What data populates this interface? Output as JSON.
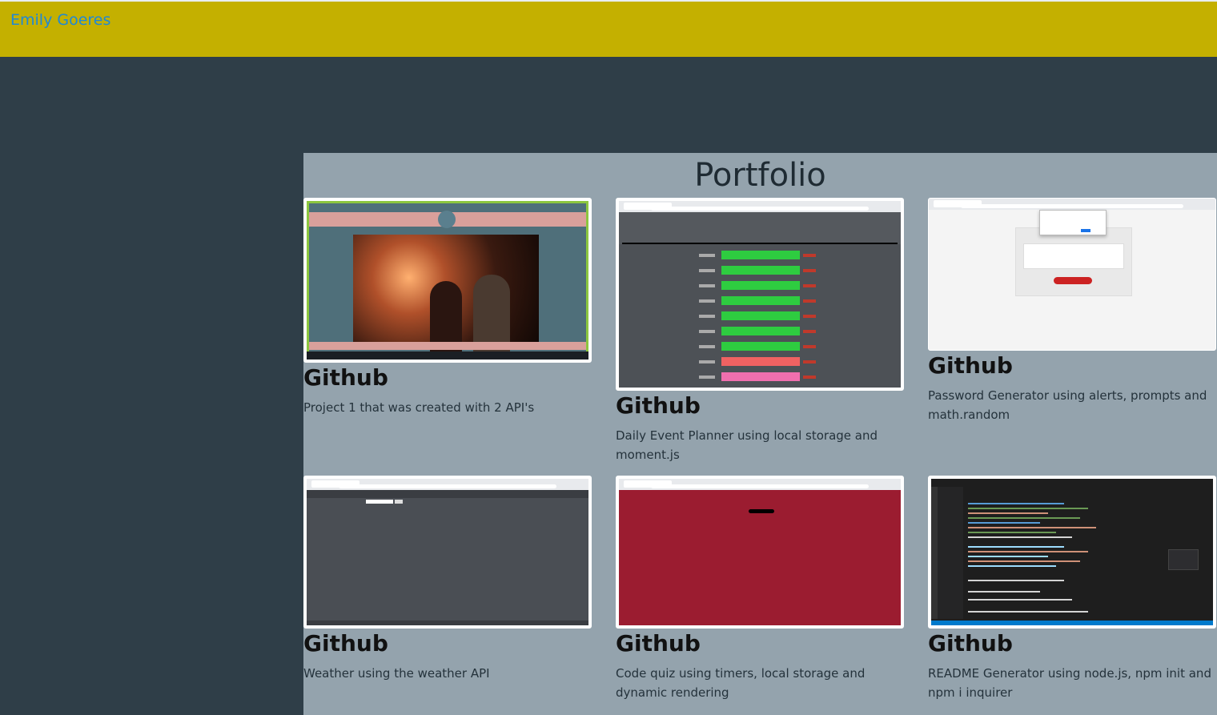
{
  "navbar": {
    "brand": "Emily Goeres"
  },
  "portfolio": {
    "title": "Portfolio",
    "projects": [
      {
        "link_label": "Github",
        "description": "Project 1 that was created with 2 API's",
        "thumbnail": "date-night-app-screenshot"
      },
      {
        "link_label": "Github",
        "description": "Daily Event Planner using local storage and moment.js",
        "thumbnail": "work-day-scheduler-screenshot"
      },
      {
        "link_label": "Github",
        "description": "Password Generator using alerts, prompts and math.random",
        "thumbnail": "password-generator-screenshot"
      },
      {
        "link_label": "Github",
        "description": "Weather using the weather API",
        "thumbnail": "weather-forecast-screenshot"
      },
      {
        "link_label": "Github",
        "description": "Code quiz using timers, local storage and dynamic rendering",
        "thumbnail": "code-quiz-screenshot"
      },
      {
        "link_label": "Github",
        "description": "README Generator using node.js, npm init and npm i inquirer",
        "thumbnail": "readme-generator-screenshot"
      }
    ]
  },
  "colors": {
    "navbar": "#c4b000",
    "brand": "#1e88d8",
    "background": "#2f3e48",
    "panel": "#94a3ad"
  }
}
